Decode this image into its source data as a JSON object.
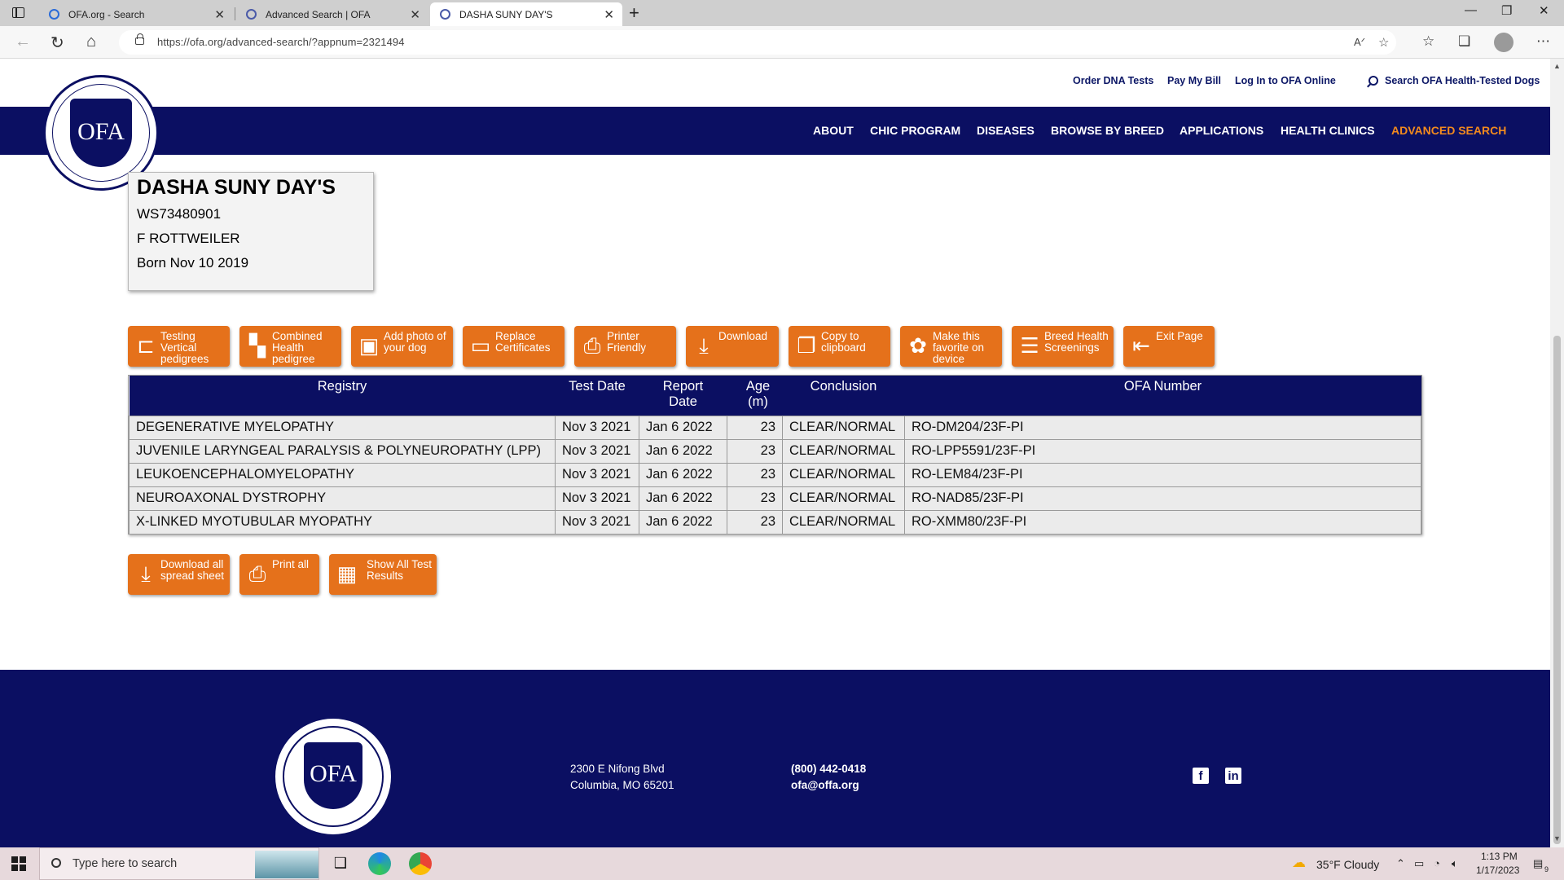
{
  "browser": {
    "tabs": [
      {
        "label": "OFA.org - Search",
        "active": false
      },
      {
        "label": "Advanced Search | OFA",
        "active": false
      },
      {
        "label": "DASHA SUNY DAY'S",
        "active": true
      }
    ],
    "url": "https://ofa.org/advanced-search/?appnum=2321494"
  },
  "utility_nav": {
    "order_dna": "Order DNA Tests",
    "pay_bill": "Pay My Bill",
    "login": "Log In to OFA Online",
    "search_dogs": "Search OFA Health-Tested Dogs"
  },
  "main_nav": {
    "items": [
      "ABOUT",
      "CHIC PROGRAM",
      "DISEASES",
      "BROWSE BY BREED",
      "APPLICATIONS",
      "HEALTH CLINICS",
      "ADVANCED SEARCH"
    ],
    "active": "ADVANCED SEARCH"
  },
  "logo": {
    "text": "OFA"
  },
  "dog": {
    "name": "DASHA SUNY DAY'S",
    "reg_number": "WS73480901",
    "sex_breed": "F ROTTWEILER",
    "born": "Born Nov 10 2019"
  },
  "actions": [
    {
      "label": "Testing Vertical pedigrees",
      "icon": "vertical-pedigree-icon"
    },
    {
      "label": "Combined Health pedigree",
      "icon": "combined-pedigree-icon"
    },
    {
      "label": "Add photo of your dog",
      "icon": "add-photo-icon"
    },
    {
      "label": "Replace Certificates",
      "icon": "certificate-icon"
    },
    {
      "label": "Printer Friendly",
      "icon": "printer-icon"
    },
    {
      "label": "Download",
      "icon": "download-icon"
    },
    {
      "label": "Copy to clipboard",
      "icon": "clipboard-icon"
    },
    {
      "label": "Make this favorite on device",
      "icon": "paw-icon"
    },
    {
      "label": "Breed Health Screenings",
      "icon": "list-icon"
    },
    {
      "label": "Exit Page",
      "icon": "exit-icon"
    }
  ],
  "results_table": {
    "headers": {
      "registry": "Registry",
      "test_date": "Test Date",
      "report_date": "Report Date",
      "age": "Age (m)",
      "conclusion": "Conclusion",
      "ofa_number": "OFA Number"
    },
    "rows": [
      {
        "registry": "DEGENERATIVE MYELOPATHY",
        "test_date": "Nov 3 2021",
        "report_date": "Jan 6 2022",
        "age": "23",
        "conclusion": "CLEAR/NORMAL",
        "ofa_number": "RO-DM204/23F-PI"
      },
      {
        "registry": "JUVENILE LARYNGEAL PARALYSIS & POLYNEUROPATHY (LPP)",
        "test_date": "Nov 3 2021",
        "report_date": "Jan 6 2022",
        "age": "23",
        "conclusion": "CLEAR/NORMAL",
        "ofa_number": "RO-LPP5591/23F-PI"
      },
      {
        "registry": "LEUKOENCEPHALOMYELOPATHY",
        "test_date": "Nov 3 2021",
        "report_date": "Jan 6 2022",
        "age": "23",
        "conclusion": "CLEAR/NORMAL",
        "ofa_number": "RO-LEM84/23F-PI"
      },
      {
        "registry": "NEUROAXONAL DYSTROPHY",
        "test_date": "Nov 3 2021",
        "report_date": "Jan 6 2022",
        "age": "23",
        "conclusion": "CLEAR/NORMAL",
        "ofa_number": "RO-NAD85/23F-PI"
      },
      {
        "registry": "X-LINKED MYOTUBULAR MYOPATHY",
        "test_date": "Nov 3 2021",
        "report_date": "Jan 6 2022",
        "age": "23",
        "conclusion": "CLEAR/NORMAL",
        "ofa_number": "RO-XMM80/23F-PI"
      }
    ]
  },
  "bottom_actions": [
    {
      "label": "Download all spread sheet",
      "icon": "download-icon"
    },
    {
      "label": "Print all",
      "icon": "printer-icon"
    },
    {
      "label": "Show All Test Results",
      "icon": "grid-icon"
    }
  ],
  "footer": {
    "address_line1": "2300 E Nifong Blvd",
    "address_line2": "Columbia, MO 65201",
    "phone": "(800) 442-0418",
    "email": "ofa@offa.org",
    "social": [
      "facebook-icon",
      "linkedin-icon"
    ]
  },
  "taskbar": {
    "search_placeholder": "Type here to search",
    "weather": "35°F  Cloudy",
    "time": "1:13 PM",
    "date": "1/17/2023",
    "notification_count": "9"
  },
  "colors": {
    "navy": "#0b0f62",
    "orange": "#e5711b",
    "nav_active": "#f28a1e"
  }
}
